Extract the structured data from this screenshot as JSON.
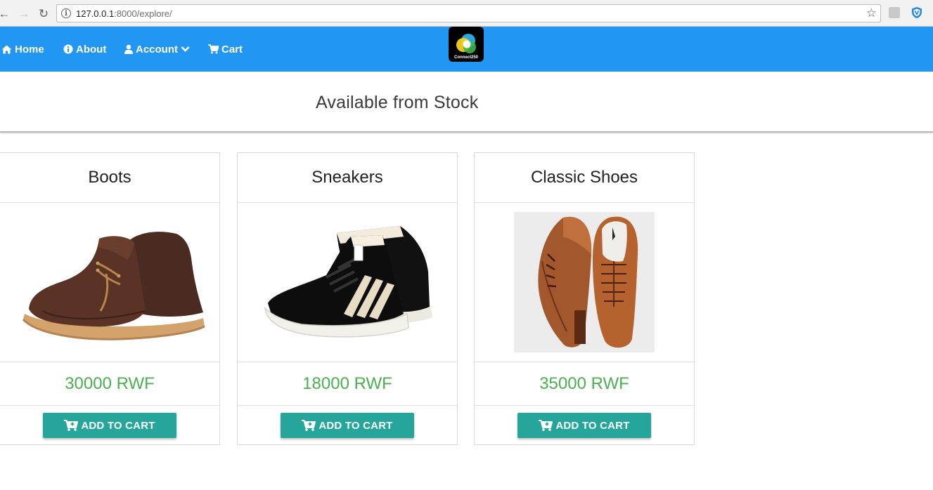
{
  "browser": {
    "url_host": "127.0.0.1",
    "url_path": ":8000/explore/"
  },
  "navbar": {
    "items": [
      {
        "label": "Home",
        "icon": "home-icon"
      },
      {
        "label": "About",
        "icon": "info-circle-icon"
      },
      {
        "label": "Account",
        "icon": "user-icon"
      },
      {
        "label": "Cart",
        "icon": "shopping-cart-icon"
      }
    ],
    "logo_text": "Connect250",
    "background_color": "#2196f3"
  },
  "header": {
    "title": "Available from Stock"
  },
  "products": [
    {
      "name": "Boots",
      "price": "30000 RWF",
      "button_label": "ADD TO CART",
      "image": "boots-image"
    },
    {
      "name": "Sneakers",
      "price": "18000 RWF",
      "button_label": "ADD TO CART",
      "image": "sneakers-image"
    },
    {
      "name": "Classic Shoes",
      "price": "35000 RWF",
      "button_label": "ADD TO CART",
      "image": "classic-shoes-image"
    }
  ],
  "colors": {
    "price_green": "#4caf50",
    "button_teal": "#26a69a"
  }
}
